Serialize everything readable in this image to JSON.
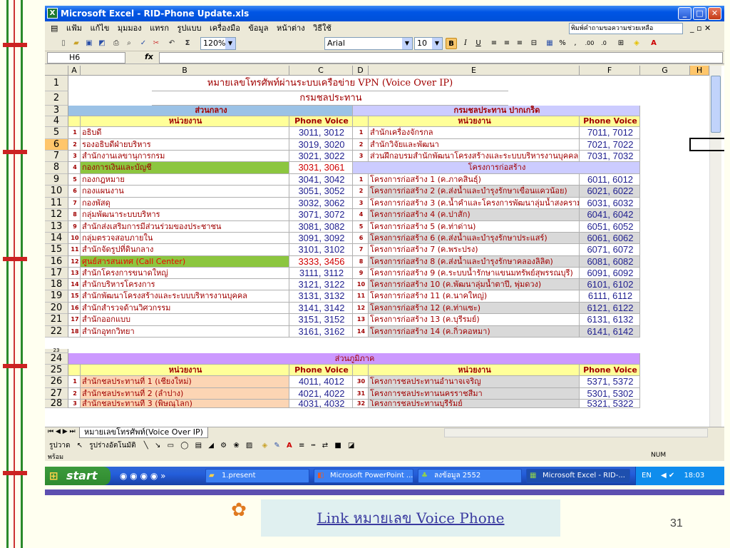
{
  "window": {
    "title": "Microsoft Excel - RID-Phone Update.xls",
    "help_placeholder": "พิมพ์คำถามขอความช่วยเหลือ"
  },
  "menu": [
    "แฟ้ม",
    "แก้ไข",
    "มุมมอง",
    "แทรก",
    "รูปแบบ",
    "เครื่องมือ",
    "ข้อมูล",
    "หน้าต่าง",
    "วิธีใช้"
  ],
  "toolbar": {
    "zoom": "120%",
    "font": "Arial",
    "size": "10",
    "sigma": "Σ",
    "bold": "B",
    "italic": "I",
    "underline": "U",
    "percent": "%",
    "comma": ","
  },
  "formula": {
    "cell": "H6",
    "fx": "fx"
  },
  "columns": [
    "A",
    "B",
    "C",
    "D",
    "E",
    "F",
    "G",
    "H"
  ],
  "header": {
    "title": "หมายเลขโทรศัพท์ผ่านระบบเครือข่าย VPN (Voice Over IP)",
    "subtitle": "กรมชลประทาน"
  },
  "sections": {
    "left_title": "ส่วนกลาง",
    "right_title": "กรมชลประทาน ปากเกร็ด",
    "col_unit": "หน่วยงาน",
    "col_phone": "Phone Voice",
    "right_sub": "โครงการก่อสร้าง",
    "region_title": "ส่วนภูมิภาค"
  },
  "row_numbers": [
    "1",
    "2",
    "3",
    "4",
    "5",
    "6",
    "7",
    "8",
    "9",
    "10",
    "11",
    "12",
    "13",
    "14",
    "15",
    "16",
    "17",
    "18",
    "19",
    "20",
    "21",
    "22",
    "23",
    "24",
    "25",
    "26",
    "27",
    "28"
  ],
  "left_rows": [
    {
      "n": "1",
      "name": "อธิบดี",
      "phone": "3011, 3012"
    },
    {
      "n": "2",
      "name": "รองอธิบดีฝ่ายบริหาร",
      "phone": "3019, 3020"
    },
    {
      "n": "3",
      "name": "สำนักงานเลขานุการกรม",
      "phone": "3021, 3022"
    },
    {
      "n": "4",
      "name": "กองการเงินและบัญชี",
      "phone": "3031, 3061"
    },
    {
      "n": "5",
      "name": "กองกฎหมาย",
      "phone": "3041, 3042"
    },
    {
      "n": "6",
      "name": "กองแผนงาน",
      "phone": "3051, 3052"
    },
    {
      "n": "7",
      "name": "กองพัสดุ",
      "phone": "3032, 3062"
    },
    {
      "n": "8",
      "name": "กลุ่มพัฒนาระบบบริหาร",
      "phone": "3071, 3072"
    },
    {
      "n": "9",
      "name": "สำนักส่งเสริมการมีส่วนร่วมของประชาชน",
      "phone": "3081, 3082"
    },
    {
      "n": "10",
      "name": "กลุ่มตรวจสอบภายใน",
      "phone": "3091, 3092"
    },
    {
      "n": "11",
      "name": "สำนักจัดรูปที่ดินกลาง",
      "phone": "3101, 3102"
    },
    {
      "n": "12",
      "name": "ศูนย์สารสนเทศ (Call Center)",
      "phone": "3333, 3456"
    },
    {
      "n": "13",
      "name": "สำนักโครงการขนาดใหญ่",
      "phone": "3111, 3112"
    },
    {
      "n": "14",
      "name": "สำนักบริหารโครงการ",
      "phone": "3121, 3122"
    },
    {
      "n": "15",
      "name": "สำนักพัฒนาโครงสร้างและระบบบริหารงานบุคคล",
      "phone": "3131, 3132"
    },
    {
      "n": "16",
      "name": "สำนักสำรวจด้านวิศวกรรม",
      "phone": "3141, 3142"
    },
    {
      "n": "17",
      "name": "สำนักออกแบบ",
      "phone": "3151, 3152"
    },
    {
      "n": "18",
      "name": "สำนักอุทกวิทยา",
      "phone": "3161, 3162"
    }
  ],
  "right_top": [
    {
      "n": "1",
      "name": "สำนักเครื่องจักรกล",
      "phone": "7011, 7012"
    },
    {
      "n": "2",
      "name": "สำนักวิจัยและพัฒนา",
      "phone": "7021, 7022"
    },
    {
      "n": "3",
      "name": "ส่วนฝึกอบรมสำนักพัฒนาโครงสร้างและระบบบริหารงานบุคคล",
      "phone": "7031, 7032"
    }
  ],
  "right_rows": [
    {
      "n": "1",
      "name": "โครงการก่อสร้าง 1 (ค.ภาคสินธุ์)",
      "phone": "6011, 6012"
    },
    {
      "n": "2",
      "name": "โครงการก่อสร้าง 2 (ค.ส่งน้ำและบำรุงรักษาเขื่อนแควน้อย)",
      "phone": "6021, 6022"
    },
    {
      "n": "3",
      "name": "โครงการก่อสร้าง 3 (ค.น้ำคำและโครงการพัฒนาลุ่มน้ำสงคราม",
      "phone": "6031, 6032"
    },
    {
      "n": "4",
      "name": "โครงการก่อสร้าง 4 (ค.ปาสัก)",
      "phone": "6041, 6042"
    },
    {
      "n": "5",
      "name": "โครงการก่อสร้าง 5 (ค.ท่าด่าน)",
      "phone": "6051, 6052"
    },
    {
      "n": "6",
      "name": "โครงการก่อสร้าง 6 (ค.ส่งน้ำและบำรุงรักษาประแสร์)",
      "phone": "6061, 6062"
    },
    {
      "n": "7",
      "name": "โครงการก่อสร้าง 7 (ค.พระปรง)",
      "phone": "6071, 6072"
    },
    {
      "n": "8",
      "name": "โครงการก่อสร้าง 8 (ค.ส่งน้ำและบำรุงรักษาคลองลิลิต)",
      "phone": "6081, 6082"
    },
    {
      "n": "9",
      "name": "โครงการก่อสร้าง 9 (ค.ระบบน้ำรักษาแขนมทรัพย์สุพรรณบุรี)",
      "phone": "6091, 6092"
    },
    {
      "n": "10",
      "name": "โครงการก่อสร้าง 10 (ค.พัฒนาลุ่มน้ำตาปี, พุ่มดวง)",
      "phone": "6101, 6102"
    },
    {
      "n": "11",
      "name": "โครงการก่อสร้าง 11 (ค.นาคใหญ่)",
      "phone": "6111, 6112"
    },
    {
      "n": "12",
      "name": "โครงการก่อสร้าง 12 (ค.ท่าแซะ)",
      "phone": "6121, 6122"
    },
    {
      "n": "13",
      "name": "โครงการก่อสร้าง 13 (ค.บุรีรมย์)",
      "phone": "6131, 6132"
    },
    {
      "n": "14",
      "name": "โครงการก่อสร้าง 14 (ค.กิ่วคอหมา)",
      "phone": "6141, 6142"
    }
  ],
  "region_rows": [
    {
      "ln": "1",
      "lname": "สำนักชลประทานที่ 1 (เชียงใหม่)",
      "lphone": "4011, 4012",
      "rn": "30",
      "rname": "โครงการชลประทานอำนาจเจริญ",
      "rphone": "5371, 5372"
    },
    {
      "ln": "2",
      "lname": "สำนักชลประทานที่ 2 (ลำปาง)",
      "lphone": "4021, 4022",
      "rn": "31",
      "rname": "โครงการชลประทานนครราชสีมา",
      "rphone": "5301, 5302"
    },
    {
      "ln": "3",
      "lname": "สำนักชลประทานที่ 3 (พิษณุโลก)",
      "lphone": "4031, 4032",
      "rn": "32",
      "rname": "โครงการชลประทานบุรีรัมย์",
      "rphone": "5321, 5322"
    }
  ],
  "sheet_tab": "หมายเลขโทรศัพท์(Voice Over IP)",
  "drawbar": {
    "draw": "รูปวาด",
    "autoshape": "รูปร่างอัตโนมัติ"
  },
  "status": {
    "ready": "พร้อม",
    "num": "NUM"
  },
  "taskbar": {
    "start": "start",
    "tasks": [
      "1.present",
      "Microsoft PowerPoint ...",
      "ลงข้อมูล 2552",
      "Microsoft Excel - RID-..."
    ],
    "lang": "EN",
    "time": "18:03"
  },
  "link": {
    "label": "Link หมายเลข Voice Phone"
  },
  "page_number": "31"
}
